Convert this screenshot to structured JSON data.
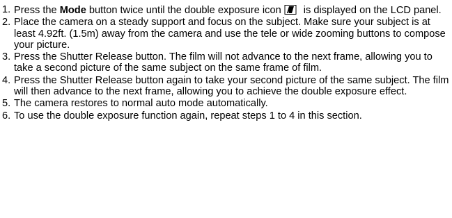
{
  "top_fragment": "",
  "steps": [
    {
      "number": "1.",
      "parts": {
        "before": "Press the ",
        "bold": "Mode",
        "middle": " button twice until the double exposure icon",
        "after": " is displayed on the LCD panel."
      },
      "icon": "double-exposure-icon"
    },
    {
      "number": "2.",
      "text": "Place the camera on a steady support and focus on the subject.  Make sure your subject is at least 4.92ft. (1.5m) away from the camera and use the tele or wide zooming buttons to compose your picture."
    },
    {
      "number": "3.",
      "text": "Press the Shutter Release button.  The film will not advance to the next frame, allowing you to take a second picture of the same subject on the same frame of film."
    },
    {
      "number": "4.",
      "text": "Press the Shutter Release button again to take your second picture of the same subject. The film will then advance to the next frame, allowing you to achieve the double exposure effect."
    },
    {
      "number": "5.",
      "text": "The camera restores to normal auto mode automatically."
    },
    {
      "number": "6.",
      "text": "To use the double exposure function again, repeat steps 1 to 4 in this section."
    }
  ]
}
